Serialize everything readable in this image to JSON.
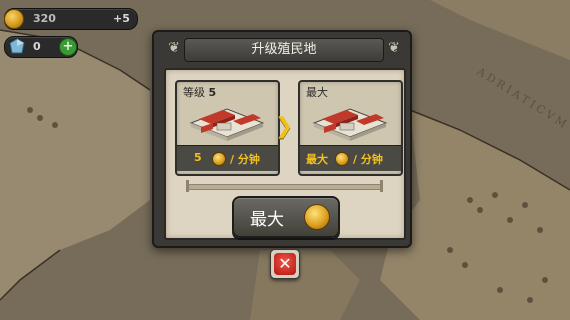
{
  "hud": {
    "gold": {
      "icon": "gold-coin-icon",
      "amount": "320",
      "income": "+5"
    },
    "gems": {
      "icon": "blue-gem-icon",
      "amount": "0",
      "add_symbol": "+"
    }
  },
  "map_labels": {
    "adriatic": "ADRIATICVM"
  },
  "dialog": {
    "title": "升级殖民地",
    "current": {
      "level_label": "等级",
      "level_value": "5",
      "rate_value": "5",
      "rate_unit": "/ 分钟"
    },
    "next": {
      "level_label": "最大",
      "rate_value": "最大",
      "rate_unit": "/ 分钟"
    },
    "upgrade_button": {
      "label": "最大",
      "icon": "laurel-coin-icon"
    },
    "close_icon": "close-x-icon"
  },
  "colors": {
    "accent_gold": "#f2c021",
    "close_red": "#d9332a",
    "panel_dark": "#3a3935"
  }
}
